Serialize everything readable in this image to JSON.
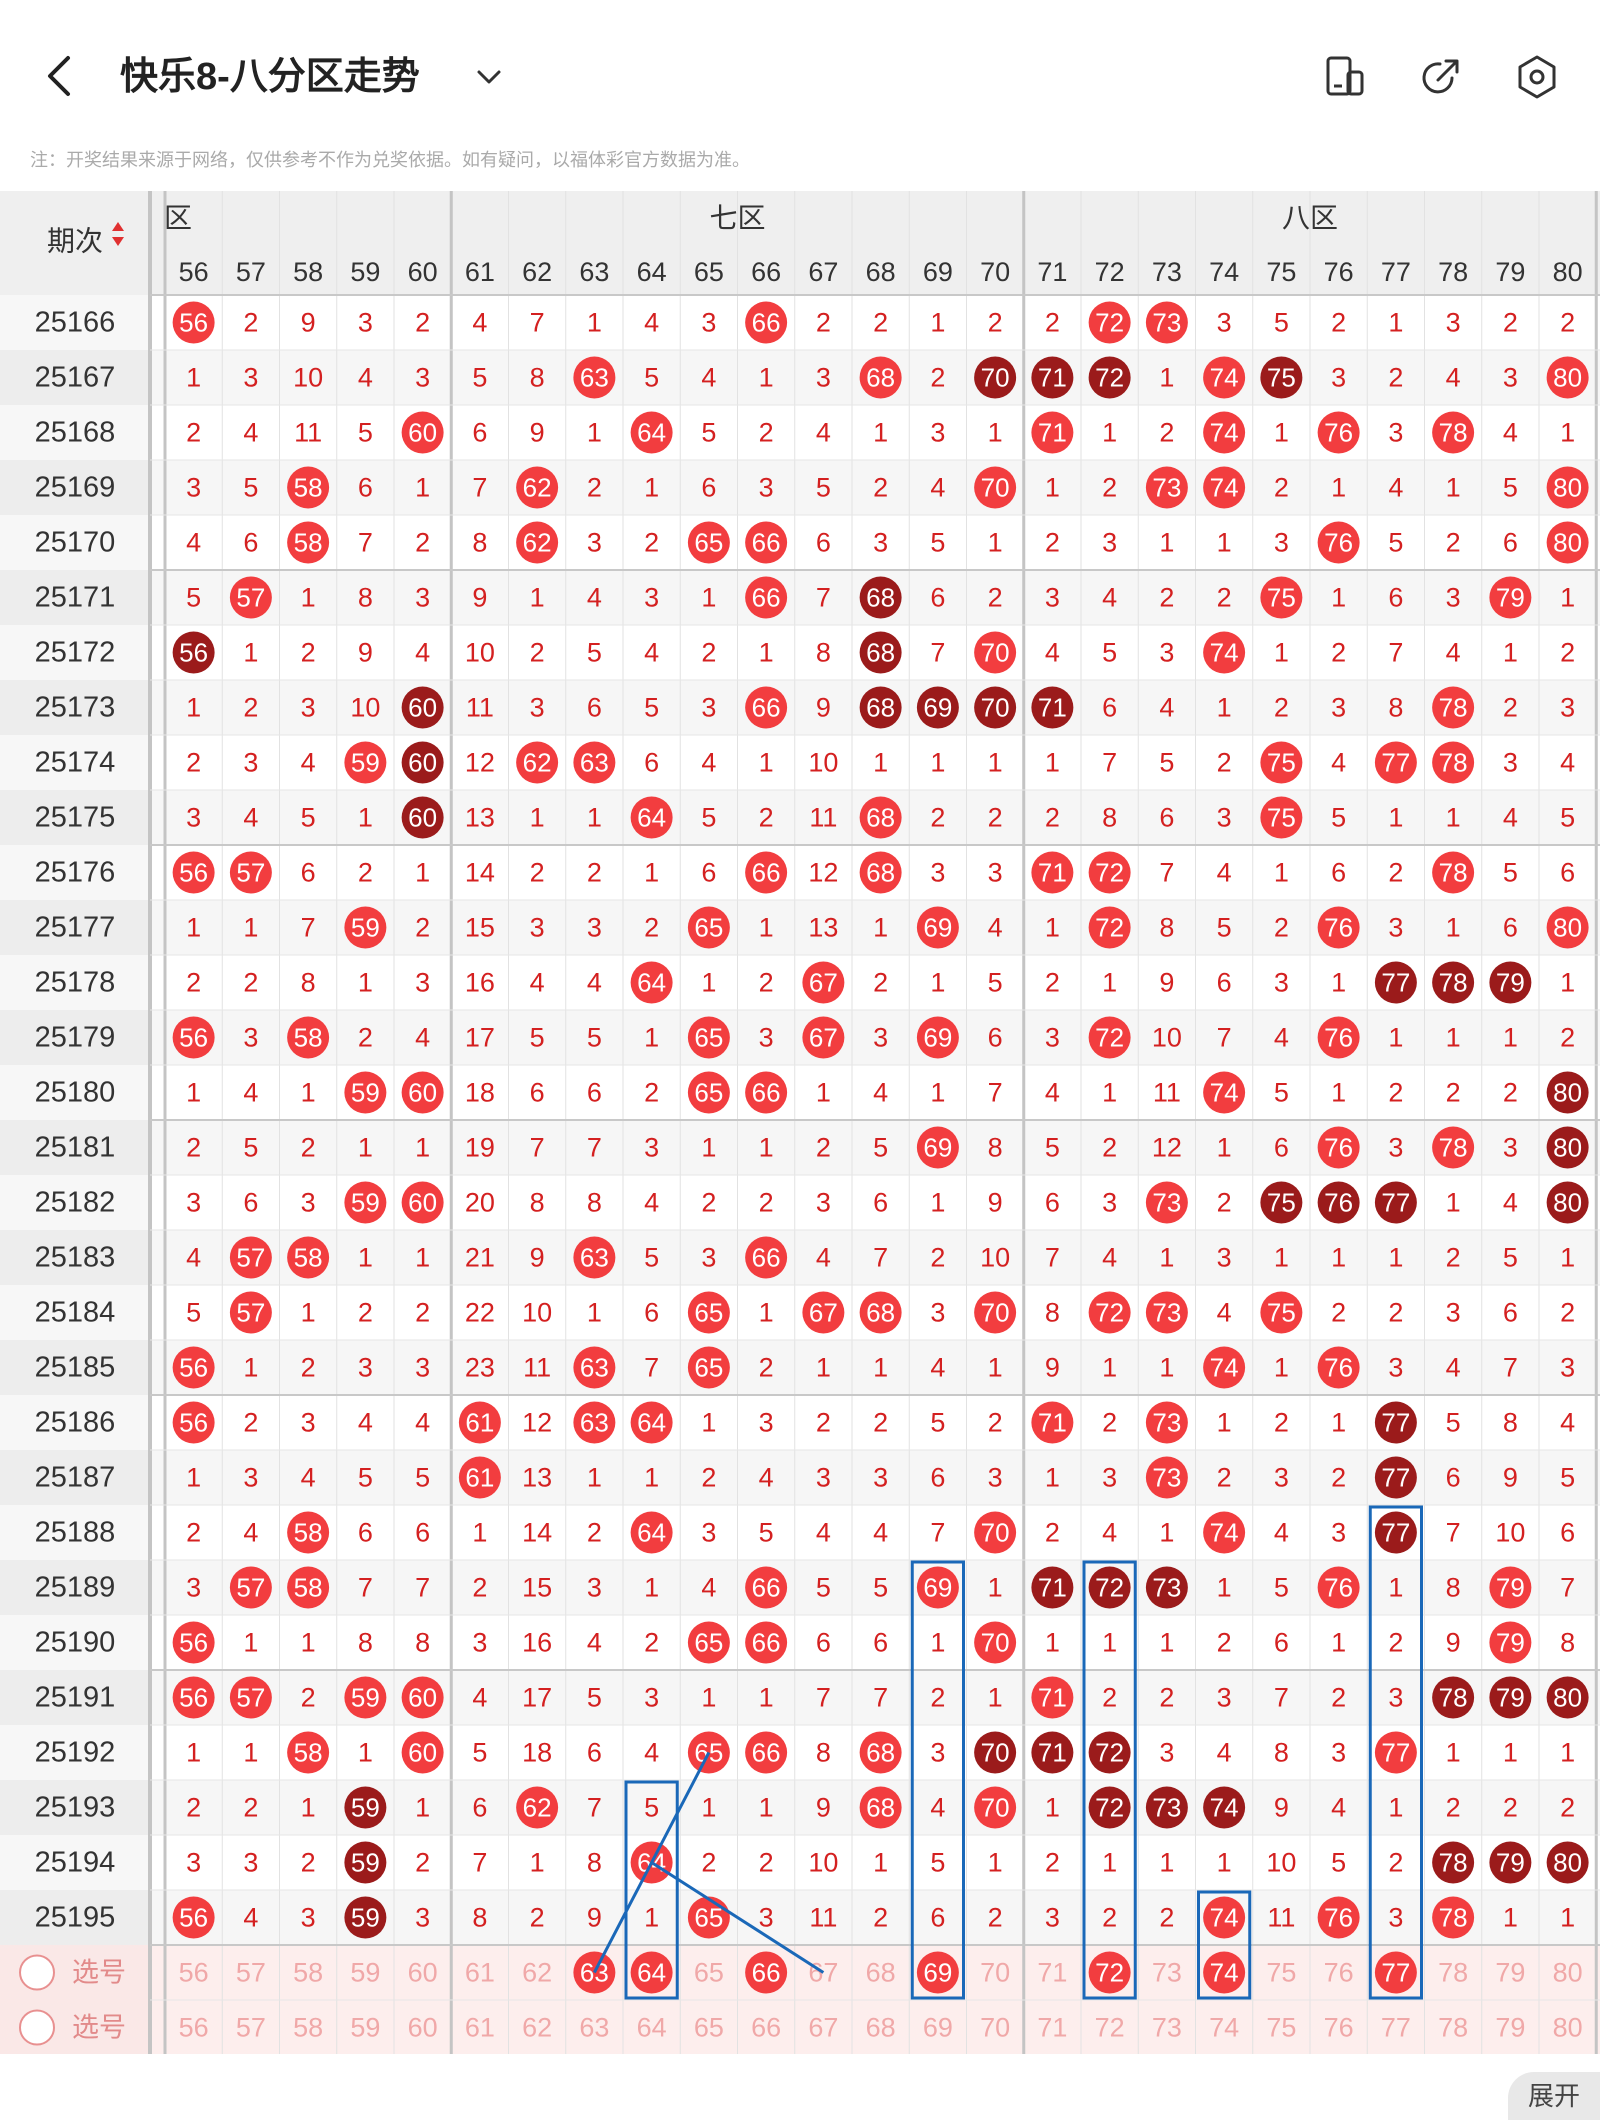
{
  "header": {
    "title": "快乐8-八分区走势",
    "icons": [
      "back-arrow-icon",
      "dropdown-chevron-icon",
      "layout-toggle-icon",
      "share-icon",
      "settings-gear-icon"
    ]
  },
  "notice": "注：开奖结果来源于网络，仅供参考不作为兑奖依据。如有疑问，以福体彩官方数据为准。",
  "table": {
    "issue_header": "期次",
    "sort_icon": "sort-updown-icon",
    "zones": [
      {
        "label": "六区",
        "shown": "区",
        "start": 56,
        "end": 60
      },
      {
        "label": "七区",
        "shown": "七区",
        "start": 61,
        "end": 70
      },
      {
        "label": "八区",
        "shown": "八区",
        "start": 71,
        "end": 80
      }
    ],
    "columns": [
      "56",
      "57",
      "58",
      "59",
      "60",
      "61",
      "62",
      "63",
      "64",
      "65",
      "66",
      "67",
      "68",
      "69",
      "70",
      "71",
      "72",
      "73",
      "74",
      "75",
      "76",
      "77",
      "78",
      "79",
      "80"
    ],
    "rows": [
      {
        "issue": "25166",
        "cells": [
          "56",
          "2",
          "9",
          "3",
          "2",
          "4",
          "7",
          "1",
          "4",
          "3",
          "66",
          "2",
          "2",
          "1",
          "2",
          "2",
          "72",
          "73",
          "3",
          "5",
          "2",
          "1",
          "3",
          "2",
          "2"
        ],
        "hl": "0000000000000000000000000"
      },
      {
        "issue": "25167",
        "cells": [
          "1",
          "3",
          "10",
          "4",
          "3",
          "5",
          "8",
          "63",
          "5",
          "4",
          "1",
          "3",
          "68",
          "2",
          "70",
          "71",
          "72",
          "1",
          "74",
          "75",
          "3",
          "2",
          "4",
          "3",
          "80"
        ],
        "hl": "0000000000000022200200000"
      },
      {
        "issue": "25168",
        "cells": [
          "2",
          "4",
          "11",
          "5",
          "60",
          "6",
          "9",
          "1",
          "64",
          "5",
          "2",
          "4",
          "1",
          "3",
          "1",
          "71",
          "1",
          "2",
          "74",
          "1",
          "76",
          "3",
          "78",
          "4",
          "1"
        ],
        "hl": "0000000000000000000200000"
      },
      {
        "issue": "25169",
        "cells": [
          "3",
          "5",
          "58",
          "6",
          "1",
          "7",
          "62",
          "2",
          "1",
          "6",
          "3",
          "5",
          "2",
          "4",
          "70",
          "1",
          "2",
          "73",
          "74",
          "2",
          "1",
          "4",
          "1",
          "5",
          "80"
        ],
        "hl": "0000000000000000000200000"
      },
      {
        "issue": "25170",
        "cells": [
          "4",
          "6",
          "58",
          "7",
          "2",
          "8",
          "62",
          "3",
          "2",
          "65",
          "66",
          "6",
          "3",
          "5",
          "1",
          "2",
          "3",
          "1",
          "1",
          "3",
          "76",
          "5",
          "2",
          "6",
          "80"
        ],
        "hl": "0000000000000000000000000"
      },
      {
        "issue": "25171",
        "cells": [
          "5",
          "57",
          "1",
          "8",
          "3",
          "9",
          "1",
          "4",
          "3",
          "1",
          "66",
          "7",
          "68",
          "6",
          "2",
          "3",
          "4",
          "2",
          "2",
          "75",
          "1",
          "6",
          "3",
          "79",
          "1"
        ],
        "hl": "0000000000002000000000000"
      },
      {
        "issue": "25172",
        "cells": [
          "56",
          "1",
          "2",
          "9",
          "4",
          "10",
          "2",
          "5",
          "4",
          "2",
          "1",
          "8",
          "68",
          "7",
          "70",
          "4",
          "5",
          "3",
          "74",
          "1",
          "2",
          "7",
          "4",
          "1",
          "2"
        ],
        "hl": "2000000000002000000000000"
      },
      {
        "issue": "25173",
        "cells": [
          "1",
          "2",
          "3",
          "10",
          "60",
          "11",
          "3",
          "6",
          "5",
          "3",
          "66",
          "9",
          "68",
          "69",
          "70",
          "71",
          "6",
          "4",
          "1",
          "2",
          "3",
          "8",
          "78",
          "2",
          "3"
        ],
        "hl": "0000200000002222000000000"
      },
      {
        "issue": "25174",
        "cells": [
          "2",
          "3",
          "4",
          "59",
          "60",
          "12",
          "62",
          "63",
          "6",
          "4",
          "1",
          "10",
          "1",
          "1",
          "1",
          "1",
          "7",
          "5",
          "2",
          "75",
          "4",
          "77",
          "78",
          "3",
          "4"
        ],
        "hl": "0000200000000000000000000"
      },
      {
        "issue": "25175",
        "cells": [
          "3",
          "4",
          "5",
          "1",
          "60",
          "13",
          "1",
          "1",
          "64",
          "5",
          "2",
          "11",
          "68",
          "2",
          "2",
          "2",
          "8",
          "6",
          "3",
          "75",
          "5",
          "1",
          "1",
          "4",
          "5"
        ],
        "hl": "0000200000000000000000000"
      },
      {
        "issue": "25176",
        "cells": [
          "56",
          "57",
          "6",
          "2",
          "1",
          "14",
          "2",
          "2",
          "1",
          "6",
          "66",
          "12",
          "68",
          "3",
          "3",
          "71",
          "72",
          "7",
          "4",
          "1",
          "6",
          "2",
          "78",
          "5",
          "6"
        ],
        "hl": "0000000000000000000000000"
      },
      {
        "issue": "25177",
        "cells": [
          "1",
          "1",
          "7",
          "59",
          "2",
          "15",
          "3",
          "3",
          "2",
          "65",
          "1",
          "13",
          "1",
          "69",
          "4",
          "1",
          "72",
          "8",
          "5",
          "2",
          "76",
          "3",
          "1",
          "6",
          "80"
        ],
        "hl": "0000000000000000000000000"
      },
      {
        "issue": "25178",
        "cells": [
          "2",
          "2",
          "8",
          "1",
          "3",
          "16",
          "4",
          "4",
          "64",
          "1",
          "2",
          "67",
          "2",
          "1",
          "5",
          "2",
          "1",
          "9",
          "6",
          "3",
          "1",
          "77",
          "78",
          "79",
          "1"
        ],
        "hl": "0000000000000000000002220"
      },
      {
        "issue": "25179",
        "cells": [
          "56",
          "3",
          "58",
          "2",
          "4",
          "17",
          "5",
          "5",
          "1",
          "65",
          "3",
          "67",
          "3",
          "69",
          "6",
          "3",
          "72",
          "10",
          "7",
          "4",
          "76",
          "1",
          "1",
          "1",
          "2"
        ],
        "hl": "0000000000000000000000000"
      },
      {
        "issue": "25180",
        "cells": [
          "1",
          "4",
          "1",
          "59",
          "60",
          "18",
          "6",
          "6",
          "2",
          "65",
          "66",
          "1",
          "4",
          "1",
          "7",
          "4",
          "1",
          "11",
          "74",
          "5",
          "1",
          "2",
          "2",
          "2",
          "80"
        ],
        "hl": "0000000000000000000000002"
      },
      {
        "issue": "25181",
        "cells": [
          "2",
          "5",
          "2",
          "1",
          "1",
          "19",
          "7",
          "7",
          "3",
          "1",
          "1",
          "2",
          "5",
          "69",
          "8",
          "5",
          "2",
          "12",
          "1",
          "6",
          "76",
          "3",
          "78",
          "3",
          "80"
        ],
        "hl": "0000000000000000000000002"
      },
      {
        "issue": "25182",
        "cells": [
          "3",
          "6",
          "3",
          "59",
          "60",
          "20",
          "8",
          "8",
          "4",
          "2",
          "2",
          "3",
          "6",
          "1",
          "9",
          "6",
          "3",
          "73",
          "2",
          "75",
          "76",
          "77",
          "1",
          "4",
          "80"
        ],
        "hl": "0000000000000000000222002"
      },
      {
        "issue": "25183",
        "cells": [
          "4",
          "57",
          "58",
          "1",
          "1",
          "21",
          "9",
          "63",
          "5",
          "3",
          "66",
          "4",
          "7",
          "2",
          "10",
          "7",
          "4",
          "1",
          "3",
          "1",
          "1",
          "1",
          "2",
          "5",
          "1"
        ],
        "hl": "0000000000000000000000000"
      },
      {
        "issue": "25184",
        "cells": [
          "5",
          "57",
          "1",
          "2",
          "2",
          "22",
          "10",
          "1",
          "6",
          "65",
          "1",
          "67",
          "68",
          "3",
          "70",
          "8",
          "72",
          "73",
          "4",
          "75",
          "2",
          "2",
          "3",
          "6",
          "2"
        ],
        "hl": "0000000000000000000000000"
      },
      {
        "issue": "25185",
        "cells": [
          "56",
          "1",
          "2",
          "3",
          "3",
          "23",
          "11",
          "63",
          "7",
          "65",
          "2",
          "1",
          "1",
          "4",
          "1",
          "9",
          "1",
          "1",
          "74",
          "1",
          "76",
          "3",
          "4",
          "7",
          "3"
        ],
        "hl": "0000000000000000000000000"
      },
      {
        "issue": "25186",
        "cells": [
          "56",
          "2",
          "3",
          "4",
          "4",
          "61",
          "12",
          "63",
          "64",
          "1",
          "3",
          "2",
          "2",
          "5",
          "2",
          "71",
          "2",
          "73",
          "1",
          "2",
          "1",
          "77",
          "5",
          "8",
          "4"
        ],
        "hl": "0000000000000000000002000"
      },
      {
        "issue": "25187",
        "cells": [
          "1",
          "3",
          "4",
          "5",
          "5",
          "61",
          "13",
          "1",
          "1",
          "2",
          "4",
          "3",
          "3",
          "6",
          "3",
          "1",
          "3",
          "73",
          "2",
          "3",
          "2",
          "77",
          "6",
          "9",
          "5"
        ],
        "hl": "0000000000000000000002000"
      },
      {
        "issue": "25188",
        "cells": [
          "2",
          "4",
          "58",
          "6",
          "6",
          "1",
          "14",
          "2",
          "64",
          "3",
          "5",
          "4",
          "4",
          "7",
          "70",
          "2",
          "4",
          "1",
          "74",
          "4",
          "3",
          "77",
          "7",
          "10",
          "6"
        ],
        "hl": "0000000000000000000002000"
      },
      {
        "issue": "25189",
        "cells": [
          "3",
          "57",
          "58",
          "7",
          "7",
          "2",
          "15",
          "3",
          "1",
          "4",
          "66",
          "5",
          "5",
          "69",
          "1",
          "71",
          "72",
          "73",
          "1",
          "5",
          "76",
          "1",
          "8",
          "79",
          "7"
        ],
        "hl": "0000000000000002220000010"
      },
      {
        "issue": "25190",
        "cells": [
          "56",
          "1",
          "1",
          "8",
          "8",
          "3",
          "16",
          "4",
          "2",
          "65",
          "66",
          "6",
          "6",
          "1",
          "70",
          "1",
          "1",
          "1",
          "2",
          "6",
          "1",
          "2",
          "9",
          "79",
          "8"
        ],
        "hl": "0000000000000000000000010"
      },
      {
        "issue": "25191",
        "cells": [
          "56",
          "57",
          "2",
          "59",
          "60",
          "4",
          "17",
          "5",
          "3",
          "1",
          "1",
          "7",
          "7",
          "2",
          "1",
          "71",
          "2",
          "2",
          "3",
          "7",
          "2",
          "3",
          "78",
          "79",
          "80"
        ],
        "hl": "0000000000000000000000222"
      },
      {
        "issue": "25192",
        "cells": [
          "1",
          "1",
          "58",
          "1",
          "60",
          "5",
          "18",
          "6",
          "4",
          "65",
          "66",
          "8",
          "68",
          "3",
          "70",
          "71",
          "72",
          "3",
          "4",
          "8",
          "3",
          "77",
          "1",
          "1",
          "1"
        ],
        "hl": "0000000000000022200000000"
      },
      {
        "issue": "25193",
        "cells": [
          "2",
          "2",
          "1",
          "59",
          "1",
          "6",
          "62",
          "7",
          "5",
          "1",
          "1",
          "9",
          "68",
          "4",
          "70",
          "1",
          "72",
          "73",
          "74",
          "9",
          "4",
          "1",
          "2",
          "2",
          "2"
        ],
        "hl": "0002000000000000222200000"
      },
      {
        "issue": "25194",
        "cells": [
          "3",
          "3",
          "2",
          "59",
          "2",
          "7",
          "1",
          "8",
          "64",
          "2",
          "2",
          "10",
          "1",
          "5",
          "1",
          "2",
          "1",
          "1",
          "1",
          "10",
          "5",
          "2",
          "78",
          "79",
          "80"
        ],
        "hl": "0002000000000000000000222"
      },
      {
        "issue": "25195",
        "cells": [
          "56",
          "4",
          "3",
          "59",
          "3",
          "8",
          "2",
          "9",
          "1",
          "65",
          "3",
          "11",
          "2",
          "6",
          "2",
          "3",
          "2",
          "2",
          "74",
          "11",
          "76",
          "3",
          "78",
          "1",
          "1"
        ],
        "hl": "0002000000000000000000000"
      }
    ],
    "select_rows": [
      {
        "label": "选号",
        "selected": [
          "63",
          "64",
          "66",
          "69",
          "72",
          "74",
          "77"
        ]
      },
      {
        "label": "选号",
        "selected": []
      }
    ]
  },
  "expand_label": "展开",
  "colors": {
    "ball_red": "#f23d3f",
    "ball_dark": "#9b1b1b",
    "digit_red": "#d42020",
    "box_blue": "#1a68b8",
    "select_bg": "#fdeeed"
  }
}
